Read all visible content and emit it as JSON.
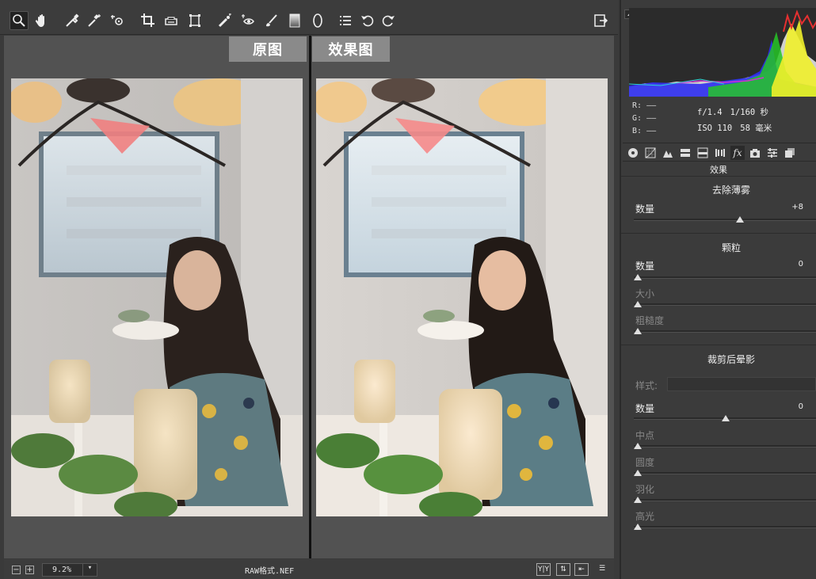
{
  "toolbar": {
    "tools": [
      {
        "icon": "zoom-icon"
      },
      {
        "icon": "hand-icon"
      },
      {
        "icon": "white-balance-icon"
      },
      {
        "icon": "color-sampler-icon"
      },
      {
        "icon": "targeted-adjustment-icon"
      },
      {
        "icon": "crop-icon"
      },
      {
        "icon": "straighten-icon"
      },
      {
        "icon": "transform-icon"
      },
      {
        "icon": "spot-removal-icon"
      },
      {
        "icon": "red-eye-icon"
      },
      {
        "icon": "adjustment-brush-icon"
      },
      {
        "icon": "graduated-filter-icon"
      },
      {
        "icon": "radial-filter-icon"
      },
      {
        "icon": "preferences-icon"
      },
      {
        "icon": "rotate-left-icon"
      },
      {
        "icon": "rotate-right-icon"
      },
      {
        "icon": "fullscreen-icon"
      }
    ]
  },
  "preview": {
    "before_label": "原图",
    "after_label": "效果图"
  },
  "status": {
    "zoom_value": "9.2%",
    "file_format": "RAW格式.NEF",
    "zoom_out": "−",
    "zoom_in": "+",
    "view_mode": "Y|Y"
  },
  "camera_info": {
    "r_label": "R:",
    "g_label": "G:",
    "b_label": "B:",
    "r_value": "——",
    "g_value": "——",
    "b_value": "——",
    "aperture": "f/1.4",
    "shutter": "1/160 秒",
    "iso": "ISO 110",
    "focal": "58 毫米"
  },
  "panel": {
    "title": "效果",
    "dehaze": {
      "title": "去除薄雾",
      "amount_label": "数量",
      "amount_value": "+8",
      "amount_level": 58
    },
    "grain": {
      "title": "颗粒",
      "amount_label": "数量",
      "amount_value": "0",
      "amount_level": 0,
      "size_label": "大小",
      "size_level": 0,
      "roughness_label": "粗糙度",
      "roughness_level": 0
    },
    "vignette": {
      "title": "裁剪后晕影",
      "style_label": "样式:",
      "amount_label": "数量",
      "amount_value": "0",
      "amount_level": 50,
      "midpoint_label": "中点",
      "midpoint_level": 0,
      "roundness_label": "圆度",
      "roundness_level": 0,
      "feather_label": "羽化",
      "feather_level": 0,
      "highlights_label": "高光",
      "highlights_level": 0
    }
  },
  "tabs": [
    "basic-icon",
    "tone-curve-icon",
    "detail-icon",
    "hsl-icon",
    "split-toning-icon",
    "lens-corrections-icon",
    "effects-icon",
    "camera-calibration-icon",
    "presets-icon",
    "snapshots-icon"
  ],
  "colors": {
    "accent": "#8a8a8a",
    "panel_bg": "#3b3b3b",
    "preview_bg": "#525252"
  }
}
